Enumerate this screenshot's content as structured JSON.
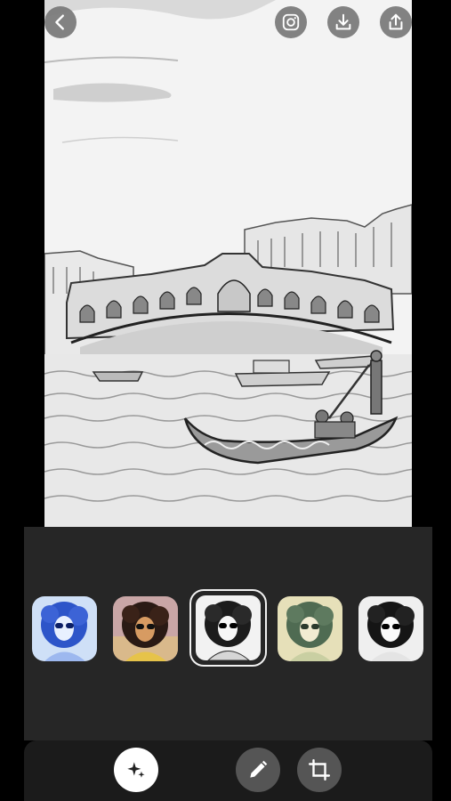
{
  "top_bar": {
    "back_icon": "chevron-left-icon",
    "instagram_icon": "instagram-icon",
    "download_icon": "download-icon",
    "share_icon": "share-icon",
    "button_color": "#787878"
  },
  "photo": {
    "style": "pencil-sketch",
    "background": "#f4f4f4"
  },
  "filters": {
    "selected_index": 2,
    "items": [
      {
        "style": "blue-tint"
      },
      {
        "style": "warm-color"
      },
      {
        "style": "black-white-sketch"
      },
      {
        "style": "vintage-green"
      },
      {
        "style": "mono-sketch"
      }
    ]
  },
  "toolbar": {
    "effects_icon": "sparkles-icon",
    "edit_icon": "pencil-icon",
    "crop_icon": "crop-icon",
    "active": "effects"
  },
  "colors": {
    "panel": "#262626",
    "toolbar": "#1b1b1b",
    "selected_border": "#f0f0f0"
  }
}
